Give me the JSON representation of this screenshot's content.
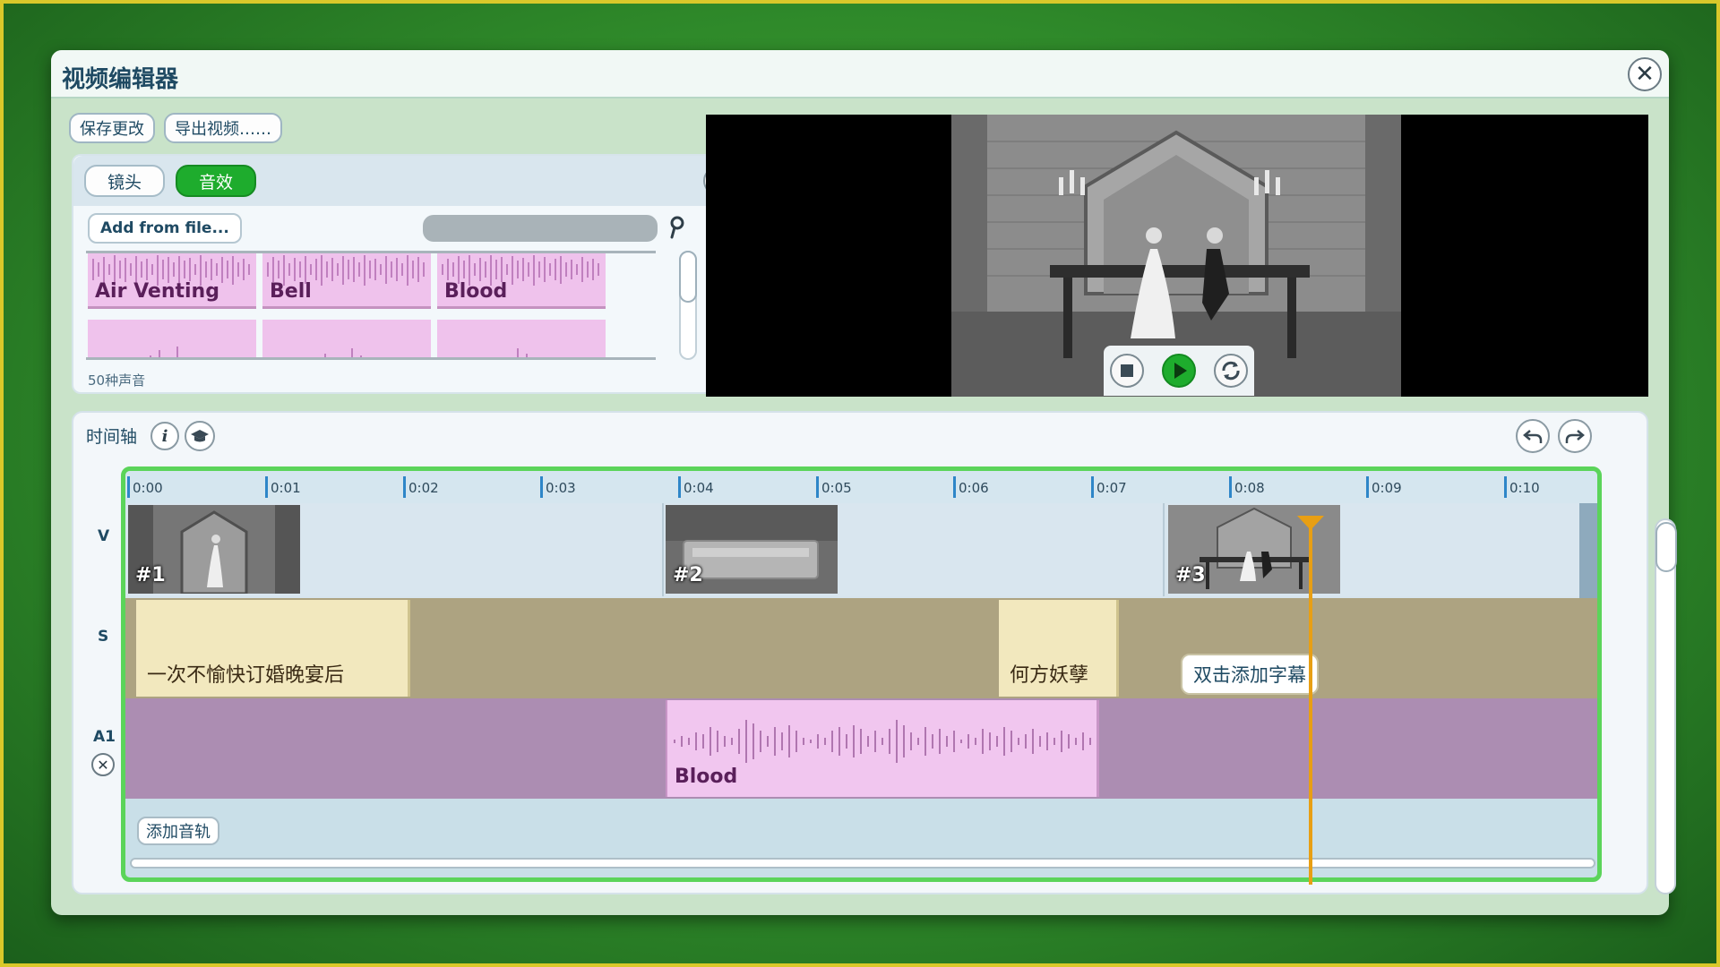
{
  "window": {
    "title": "视频编辑器",
    "close_label": "✕"
  },
  "toolbar": {
    "save_label": "保存更改",
    "export_label": "导出视频……"
  },
  "library": {
    "tabs": [
      {
        "label": "镜头",
        "active": false
      },
      {
        "label": "音效",
        "active": true
      }
    ],
    "info_label": "i",
    "add_from_file_label": "Add from file...",
    "search_placeholder": "",
    "sounds": [
      "Air Venting",
      "Bell",
      "Blood"
    ],
    "count_label": "50种声音"
  },
  "preview": {
    "controls": [
      "stop-icon",
      "play-icon",
      "loop-icon"
    ]
  },
  "timeline": {
    "label": "时间轴",
    "info_label": "i",
    "ticks": [
      "0:00",
      "0:01",
      "0:02",
      "0:03",
      "0:04",
      "0:05",
      "0:06",
      "0:07",
      "0:08",
      "0:09",
      "0:10"
    ],
    "tracks": {
      "video": {
        "label": "V",
        "clips": [
          "#1",
          "#2",
          "#3"
        ]
      },
      "subtitle": {
        "label": "S",
        "clips": [
          "一次不愉快订婚晚宴后",
          "何方妖孽"
        ],
        "hint": "双击添加字幕"
      },
      "audio": {
        "label": "A1",
        "remove_label": "✕",
        "clip_name": "Blood"
      }
    },
    "add_track_label": "添加音轨"
  },
  "colors": {
    "accent_green": "#1eac2d",
    "timeline_border": "#5bd45a",
    "playhead": "#e89f14",
    "audio_clip": "#f1c6ef",
    "subtitle_clip": "#f2e8be"
  }
}
